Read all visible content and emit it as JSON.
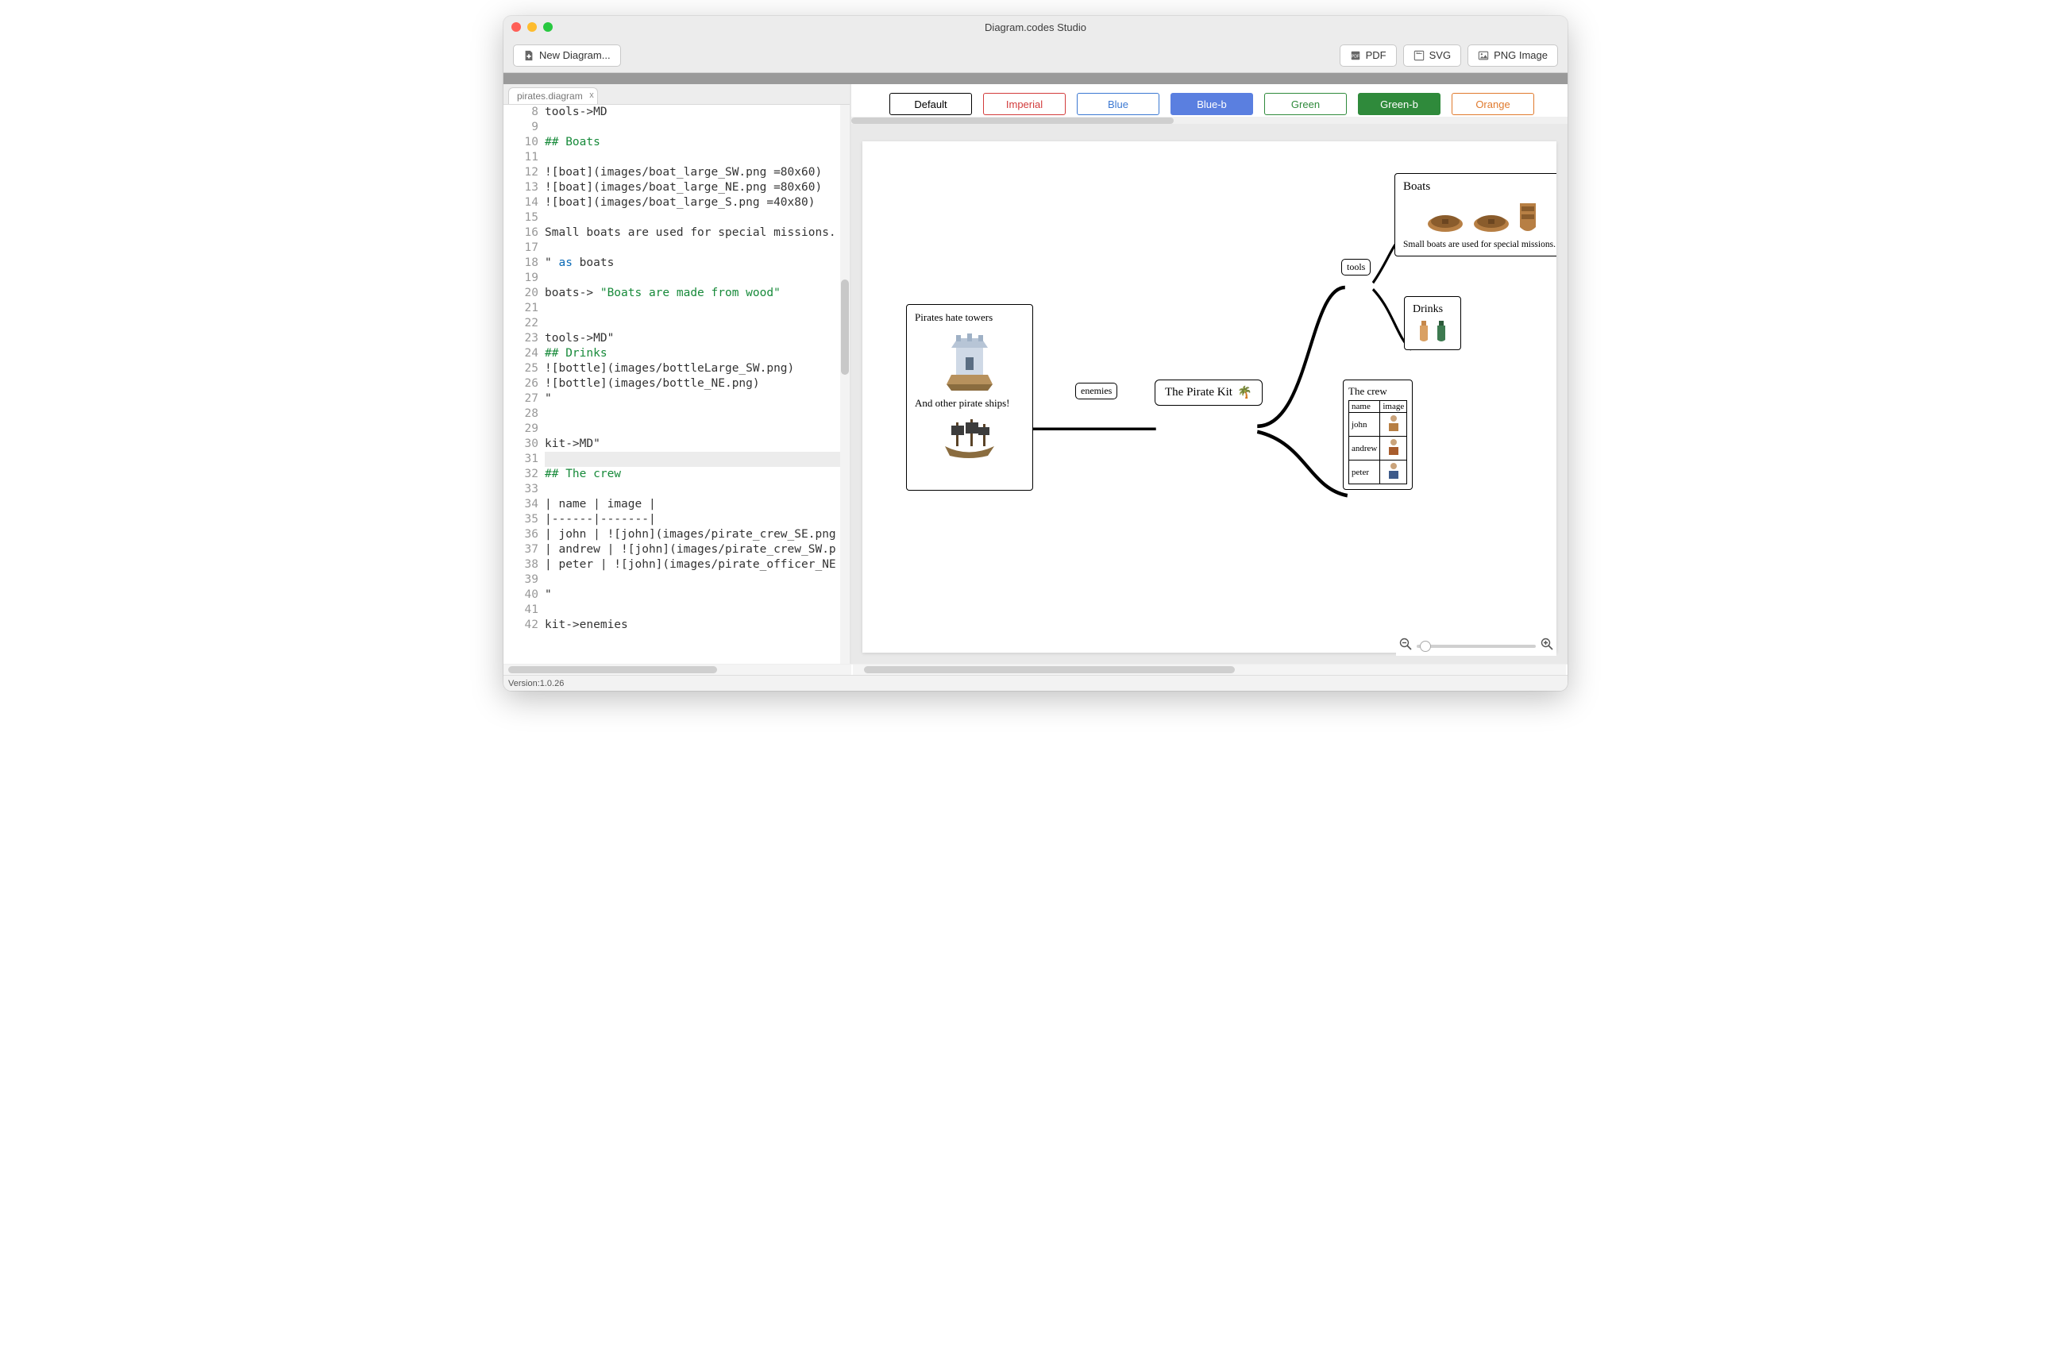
{
  "window": {
    "title": "Diagram.codes Studio"
  },
  "toolbar": {
    "new_diagram": "New Diagram...",
    "export_pdf": "PDF",
    "export_svg": "SVG",
    "export_png": "PNG Image"
  },
  "tabs": {
    "active": "pirates.diagram",
    "close": "x"
  },
  "editor": {
    "first_line_number": 8,
    "highlight_line": 31,
    "lines": [
      {
        "n": 8,
        "raw": "tools->MD"
      },
      {
        "n": 9,
        "raw": ""
      },
      {
        "n": 10,
        "raw": "## Boats",
        "cls": "com"
      },
      {
        "n": 11,
        "raw": ""
      },
      {
        "n": 12,
        "raw": "![boat](images/boat_large_SW.png =80x60)"
      },
      {
        "n": 13,
        "raw": "![boat](images/boat_large_NE.png =80x60)"
      },
      {
        "n": 14,
        "raw": "![boat](images/boat_large_S.png =40x80)"
      },
      {
        "n": 15,
        "raw": ""
      },
      {
        "n": 16,
        "raw": "Small boats are used for special missions."
      },
      {
        "n": 17,
        "raw": ""
      },
      {
        "n": 18,
        "raw": "\" as boats",
        "tokens": [
          [
            "\"",
            ""
          ],
          [
            " ",
            " "
          ],
          [
            "as",
            "key"
          ],
          [
            " boats",
            ""
          ]
        ]
      },
      {
        "n": 19,
        "raw": ""
      },
      {
        "n": 20,
        "raw": "boats-> \"Boats are made from wood\"",
        "tokens": [
          [
            "boats-> ",
            ""
          ],
          [
            "\"Boats are made from wood\"",
            "str"
          ]
        ]
      },
      {
        "n": 21,
        "raw": ""
      },
      {
        "n": 22,
        "raw": ""
      },
      {
        "n": 23,
        "raw": "tools->MD\""
      },
      {
        "n": 24,
        "raw": "## Drinks",
        "cls": "com"
      },
      {
        "n": 25,
        "raw": "![bottle](images/bottleLarge_SW.png)"
      },
      {
        "n": 26,
        "raw": "![bottle](images/bottle_NE.png)"
      },
      {
        "n": 27,
        "raw": "\""
      },
      {
        "n": 28,
        "raw": ""
      },
      {
        "n": 29,
        "raw": ""
      },
      {
        "n": 30,
        "raw": "kit->MD\""
      },
      {
        "n": 31,
        "raw": ""
      },
      {
        "n": 32,
        "raw": "## The crew",
        "cls": "com"
      },
      {
        "n": 33,
        "raw": ""
      },
      {
        "n": 34,
        "raw": "| name | image |"
      },
      {
        "n": 35,
        "raw": "|------|-------|"
      },
      {
        "n": 36,
        "raw": "| john | ![john](images/pirate_crew_SE.png"
      },
      {
        "n": 37,
        "raw": "| andrew | ![john](images/pirate_crew_SW.p"
      },
      {
        "n": 38,
        "raw": "| peter | ![john](images/pirate_officer_NE"
      },
      {
        "n": 39,
        "raw": ""
      },
      {
        "n": 40,
        "raw": "\""
      },
      {
        "n": 41,
        "raw": ""
      },
      {
        "n": 42,
        "raw": "kit->enemies"
      }
    ]
  },
  "themes": [
    {
      "label": "Default",
      "border": "#000000",
      "text": "#000000",
      "bg": "#ffffff"
    },
    {
      "label": "Imperial",
      "border": "#d23b3b",
      "text": "#d23b3b",
      "bg": "#ffffff"
    },
    {
      "label": "Blue",
      "border": "#3b78d2",
      "text": "#3b78d2",
      "bg": "#ffffff"
    },
    {
      "label": "Blue-b",
      "border": "#5a7fe0",
      "text": "#ffffff",
      "bg": "#5a7fe0"
    },
    {
      "label": "Green",
      "border": "#2f8a3b",
      "text": "#2f8a3b",
      "bg": "#ffffff"
    },
    {
      "label": "Green-b",
      "border": "#2f8a3b",
      "text": "#ffffff",
      "bg": "#2f8a3b"
    },
    {
      "label": "Orange",
      "border": "#e07a2d",
      "text": "#e07a2d",
      "bg": "#ffffff"
    }
  ],
  "diagram": {
    "center_label": "The Pirate Kit",
    "center_emoji": "🌴",
    "edge_enemies": "enemies",
    "edge_tools": "tools",
    "enemies_node": {
      "line1": "Pirates hate towers",
      "line2": "And other pirate ships!"
    },
    "boats_node": {
      "title": "Boats",
      "caption": "Small boats are used for special missions."
    },
    "drinks_node": {
      "title": "Drinks"
    },
    "crew_node": {
      "title": "The crew",
      "columns": [
        "name",
        "image"
      ],
      "rows": [
        "john",
        "andrew",
        "peter"
      ]
    }
  },
  "status": {
    "version": "Version:1.0.26"
  }
}
